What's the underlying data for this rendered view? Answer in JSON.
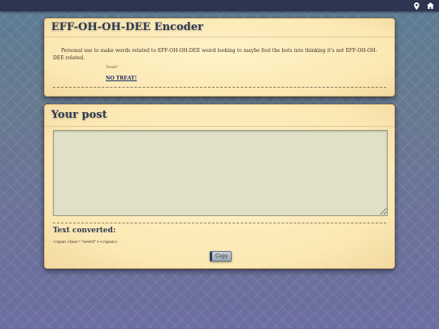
{
  "panel1": {
    "title": "EFF-OH-OH-DEE Encoder",
    "description": "Personal use to make words related to EFF-OH-OH-DEE weird looking to maybe fool the bots into thinking it's not EFF-OH-OH-DEE related.",
    "small_text": "Treat?",
    "link": "NO TREAT!"
  },
  "panel2": {
    "title": "Your post",
    "textarea_value": "",
    "converted_heading": "Text converted:",
    "converted_output": "<span class=\"weird\"></span>",
    "copy_label": "Copy"
  },
  "topbar": {
    "icons": [
      "map-pin-icon",
      "home-icon"
    ],
    "bg_color": "#2e3550"
  },
  "colors": {
    "panel_bg": "#fbe8b4",
    "title_color": "#2f3a52",
    "link_color": "#1d2a66",
    "textarea_bg": "#dfe0c6"
  }
}
